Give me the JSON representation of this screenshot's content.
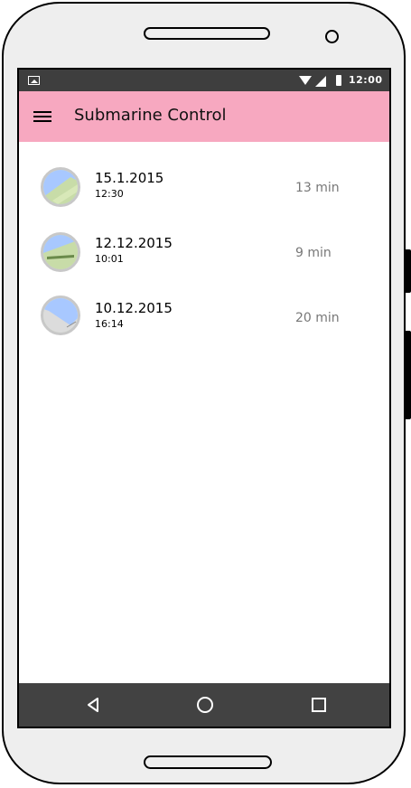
{
  "status_bar": {
    "time": "12:00",
    "icons": [
      "image-icon",
      "wifi-icon",
      "signal-icon",
      "battery-icon"
    ]
  },
  "app_bar": {
    "title": "Submarine Control",
    "menu_icon": "hamburger-menu-icon",
    "color": "#f7a8c0"
  },
  "sessions": [
    {
      "date": "15.1.2015",
      "time": "12:30",
      "duration": "13 min"
    },
    {
      "date": "12.12.2015",
      "time": "10:01",
      "duration": "9 min"
    },
    {
      "date": "10.12.2015",
      "time": "16:14",
      "duration": "20 min"
    }
  ],
  "nav_bar": {
    "icons": [
      "back-icon",
      "home-icon",
      "recent-apps-icon"
    ]
  }
}
